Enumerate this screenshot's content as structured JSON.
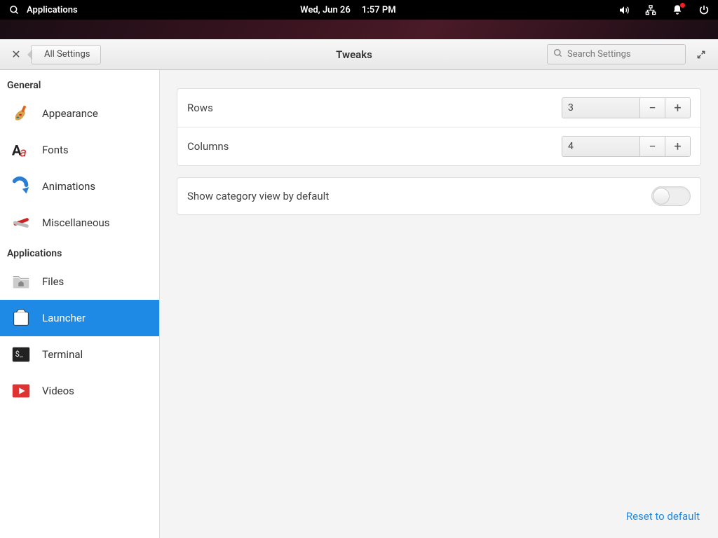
{
  "panel": {
    "apps_label": "Applications",
    "date": "Wed, Jun 26",
    "time": "1:57 PM"
  },
  "header": {
    "back_label": "All Settings",
    "title": "Tweaks",
    "search_placeholder": "Search Settings"
  },
  "sidebar": {
    "sections": [
      {
        "title": "General",
        "items": [
          {
            "label": "Appearance",
            "icon": "appearance"
          },
          {
            "label": "Fonts",
            "icon": "fonts"
          },
          {
            "label": "Animations",
            "icon": "animations"
          },
          {
            "label": "Miscellaneous",
            "icon": "miscellaneous"
          }
        ]
      },
      {
        "title": "Applications",
        "items": [
          {
            "label": "Files",
            "icon": "files"
          },
          {
            "label": "Launcher",
            "icon": "launcher",
            "active": true
          },
          {
            "label": "Terminal",
            "icon": "terminal"
          },
          {
            "label": "Videos",
            "icon": "videos"
          }
        ]
      }
    ]
  },
  "settings": {
    "rows_label": "Rows",
    "rows_value": "3",
    "columns_label": "Columns",
    "columns_value": "4",
    "category_label": "Show category view by default",
    "category_enabled": false,
    "reset_label": "Reset to default"
  }
}
